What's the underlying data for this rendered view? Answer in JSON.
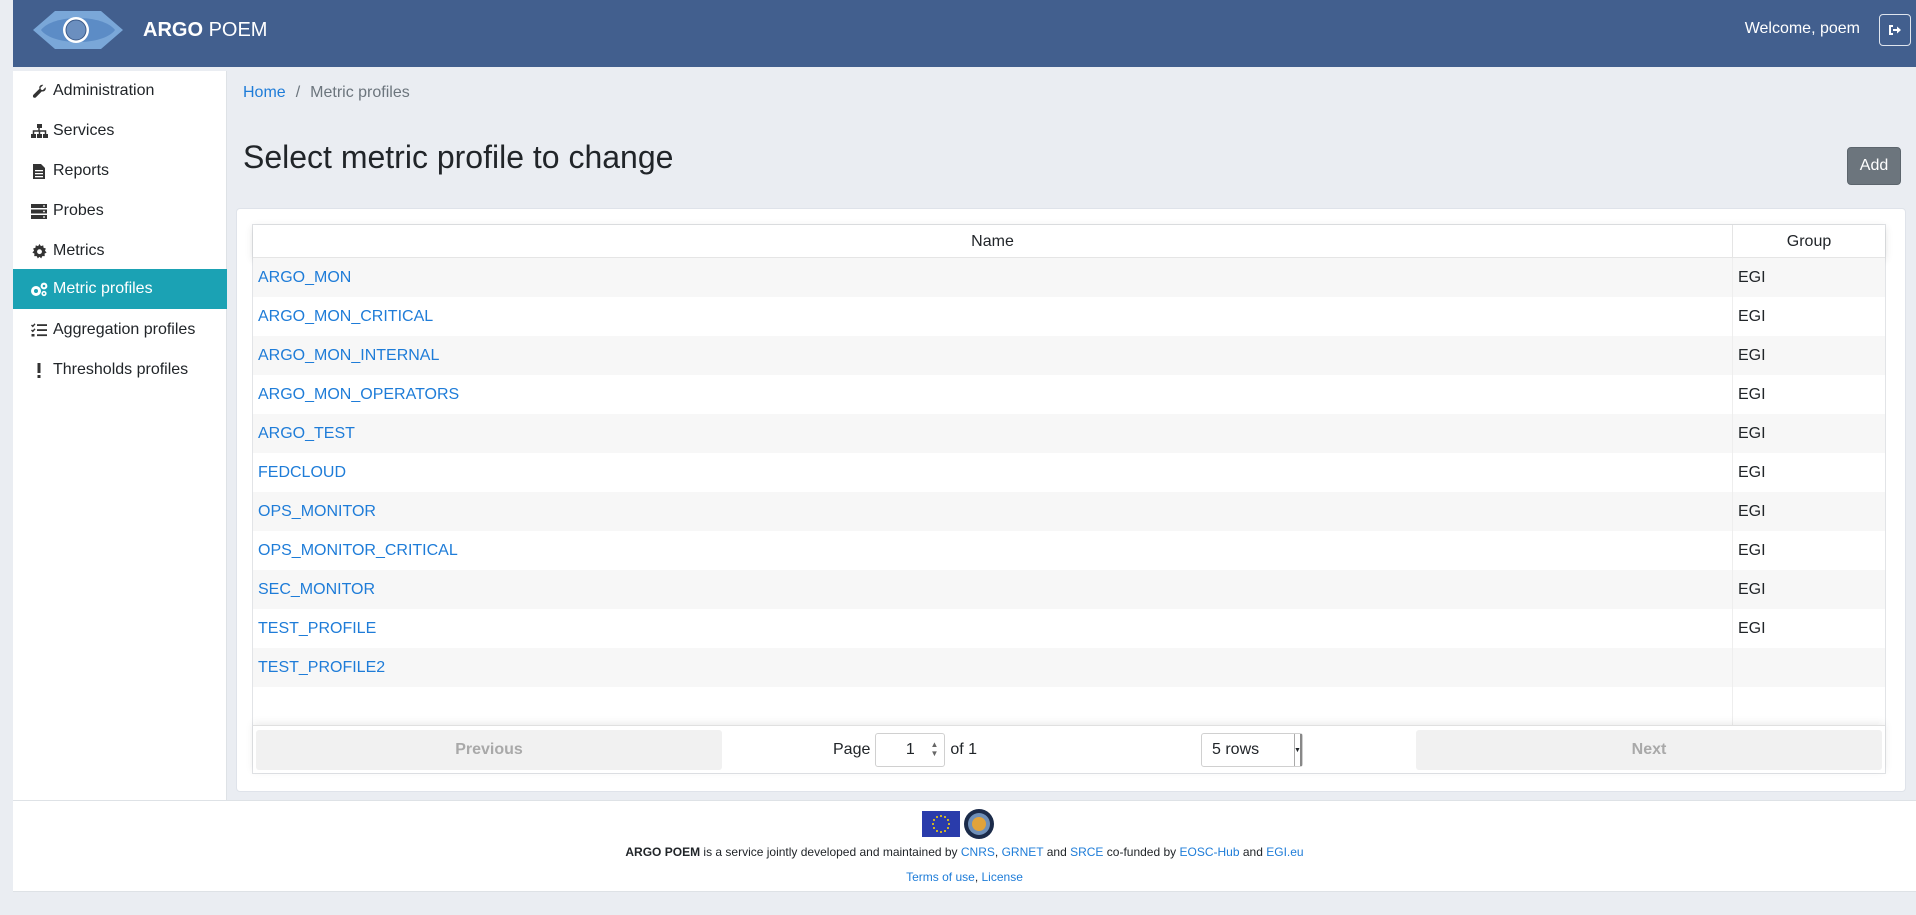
{
  "header": {
    "brand_bold": "ARGO",
    "brand_light": "POEM",
    "welcome": "Welcome, poem",
    "logout_icon": "sign-out-icon"
  },
  "sidebar": {
    "items": [
      {
        "label": "Administration",
        "icon": "wrench-icon"
      },
      {
        "label": "Services",
        "icon": "sitemap-icon"
      },
      {
        "label": "Reports",
        "icon": "file-text-icon"
      },
      {
        "label": "Probes",
        "icon": "server-icon"
      },
      {
        "label": "Metrics",
        "icon": "gear-icon"
      },
      {
        "label": "Metric profiles",
        "icon": "gears-icon",
        "active": true
      },
      {
        "label": "Aggregation profiles",
        "icon": "tasks-icon"
      },
      {
        "label": "Thresholds profiles",
        "icon": "exclamation-icon"
      }
    ],
    "active_color": "#1ba2b4"
  },
  "breadcrumb": {
    "home": "Home",
    "separator": "/",
    "current": "Metric profiles"
  },
  "main": {
    "title": "Select metric profile to change",
    "add_label": "Add"
  },
  "table": {
    "columns": [
      "Name",
      "Group"
    ],
    "rows": [
      {
        "name": "ARGO_MON",
        "group": "EGI"
      },
      {
        "name": "ARGO_MON_CRITICAL",
        "group": "EGI"
      },
      {
        "name": "ARGO_MON_INTERNAL",
        "group": "EGI"
      },
      {
        "name": "ARGO_MON_OPERATORS",
        "group": "EGI"
      },
      {
        "name": "ARGO_TEST",
        "group": "EGI"
      },
      {
        "name": "FEDCLOUD",
        "group": "EGI"
      },
      {
        "name": "OPS_MONITOR",
        "group": "EGI"
      },
      {
        "name": "OPS_MONITOR_CRITICAL",
        "group": "EGI"
      },
      {
        "name": "SEC_MONITOR",
        "group": "EGI"
      },
      {
        "name": "TEST_PROFILE",
        "group": "EGI"
      },
      {
        "name": "TEST_PROFILE2",
        "group": ""
      }
    ]
  },
  "pagination": {
    "previous": "Previous",
    "next": "Next",
    "page_label": "Page",
    "page_value": "1",
    "of_label": "of 1",
    "rows_select": "5 rows"
  },
  "footer": {
    "brand": "ARGO POEM",
    "text1": " is a service jointly developed and maintained by ",
    "cnrs": "CNRS",
    "comma": ",",
    "grnet": "GRNET",
    "and1": " and ",
    "srce": "SRCE",
    "cofunded": " co-funded by ",
    "eosc": "EOSC-Hub",
    "and2": " and ",
    "egi": "EGI.eu",
    "terms": "Terms of use",
    "comma2": ", ",
    "license": "License"
  },
  "colors": {
    "header_bg": "#425f8e",
    "link": "#1e7cd8",
    "add_button": "#6c757d"
  }
}
